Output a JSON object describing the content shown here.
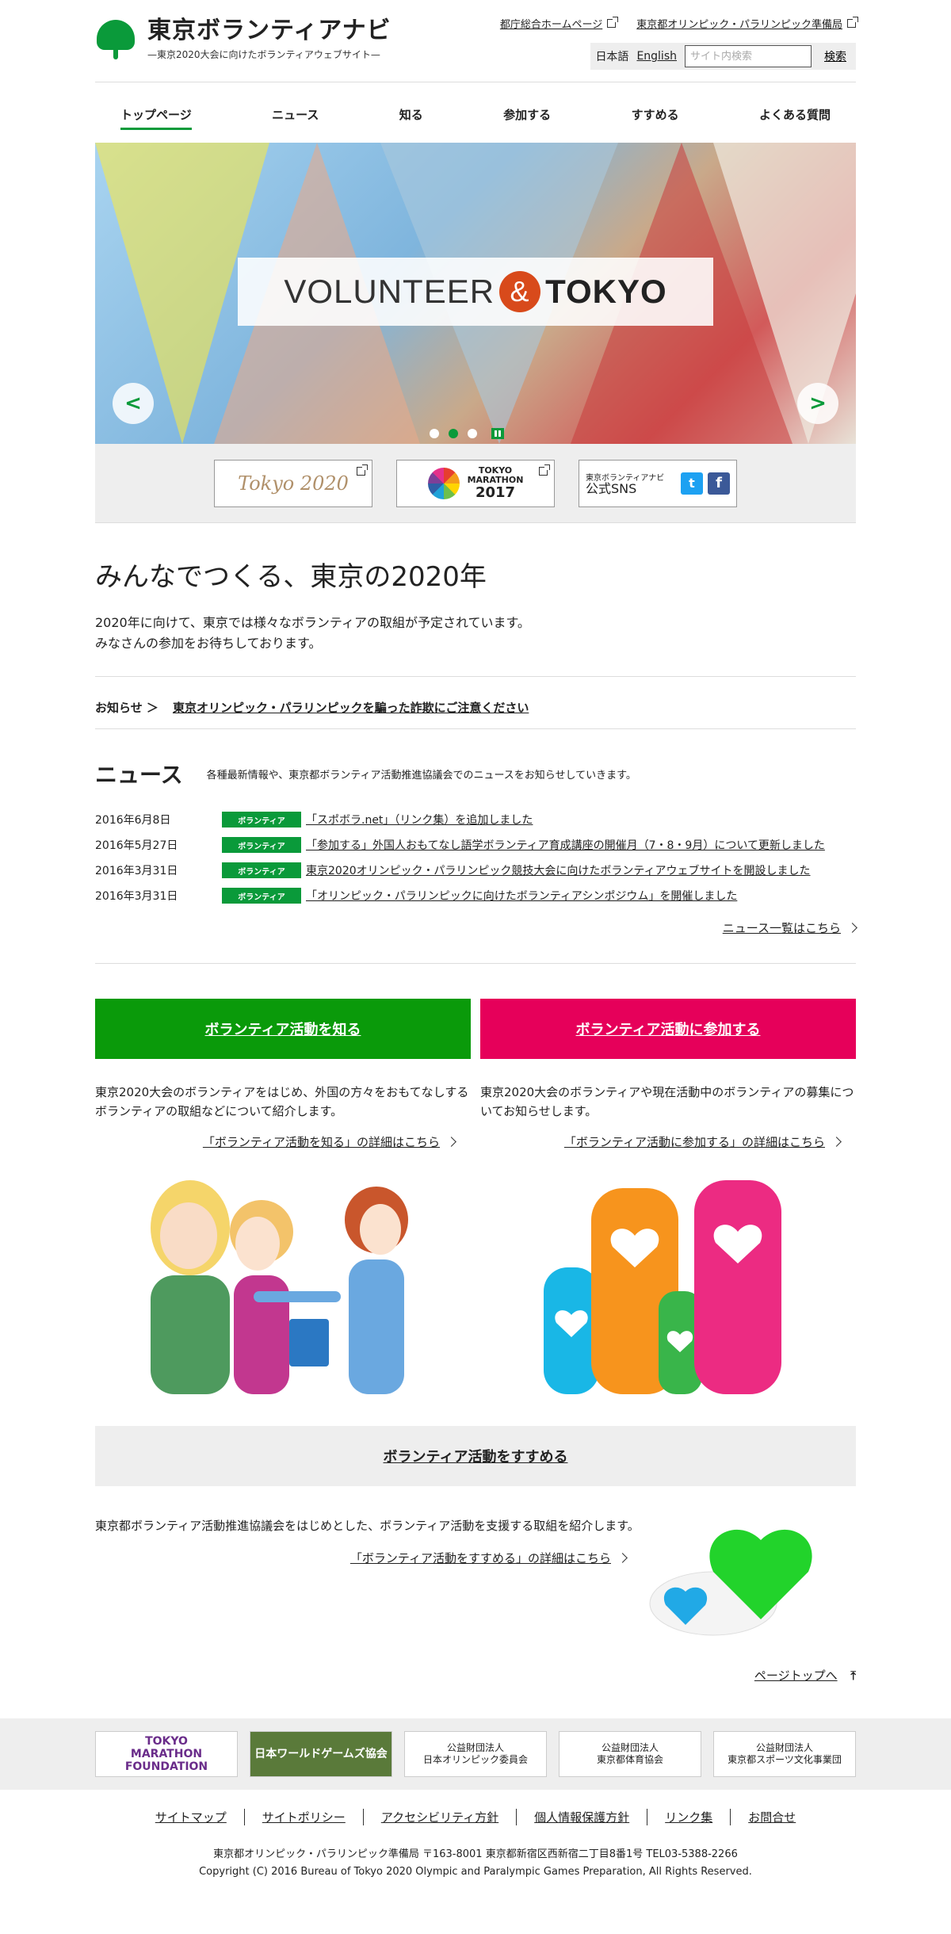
{
  "header": {
    "logo_title": "東京ボランティアナビ",
    "logo_sub": "—東京2020大会に向けたボランティアウェブサイト—",
    "toplinks": [
      "都庁総合ホームページ",
      "東京都オリンピック・パラリンピック準備局"
    ],
    "lang_ja": "日本語",
    "lang_en": "English",
    "search_placeholder": "サイト内検索",
    "search_button": "検索"
  },
  "nav": [
    "トップページ",
    "ニュース",
    "知る",
    "参加する",
    "すすめる",
    "よくある質問"
  ],
  "hero": {
    "title_left": "VOLUNTEER",
    "title_amp": "&",
    "title_right": "TOKYO",
    "prev": "<",
    "next": ">"
  },
  "banners": {
    "tokyo2020": "Tokyo 2020",
    "marathon_line1": "TOKYO",
    "marathon_line2": "MARATHON",
    "marathon_year": "2017",
    "sns_line1": "東京ボランティアナビ",
    "sns_line2": "公式SNS",
    "twitter": "t",
    "facebook": "f"
  },
  "intro": {
    "heading": "みんなでつくる、東京の2020年",
    "line1": "2020年に向けて、東京では様々なボランティアの取組が予定されています。",
    "line2": "みなさんの参加をお待ちしております。"
  },
  "notice": {
    "label": "お知らせ ＞",
    "link": "東京オリンピック・パラリンピックを騙った詐欺にご注意ください"
  },
  "news": {
    "heading": "ニュース",
    "desc": "各種最新情報や、東京都ボランティア活動推進協議会でのニュースをお知らせしていきます。",
    "items": [
      {
        "date": "2016年6月8日",
        "tag": "ボランティア",
        "title": "「スポボラ.net」（リンク集）を追加しました"
      },
      {
        "date": "2016年5月27日",
        "tag": "ボランティア",
        "title": "「参加する」外国人おもてなし語学ボランティア育成講座の開催月（7・8・9月）について更新しました"
      },
      {
        "date": "2016年3月31日",
        "tag": "ボランティア",
        "title": "東京2020オリンピック・パラリンピック競技大会に向けたボランティアウェブサイトを開設しました"
      },
      {
        "date": "2016年3月31日",
        "tag": "ボランティア",
        "title": "「オリンピック・パラリンピックに向けたボランティアシンポジウム」を開催しました"
      }
    ],
    "more": "ニュース一覧はこちら"
  },
  "know": {
    "button": "ボランティア活動を知る",
    "text": "東京2020大会のボランティアをはじめ、外国の方々をおもてなしするボランティアの取組などについて紹介します。",
    "more": "「ボランティア活動を知る」の詳細はこちら"
  },
  "join": {
    "button": "ボランティア活動に参加する",
    "text": "東京2020大会のボランティアや現在活動中のボランティアの募集についてお知らせします。",
    "more": "「ボランティア活動に参加する」の詳細はこちら"
  },
  "recommend": {
    "button": "ボランティア活動をすすめる",
    "text": "東京都ボランティア活動推進協議会をはじめとした、ボランティア活動を支援する取組を紹介します。",
    "more": "「ボランティア活動をすすめる」の詳細はこちら"
  },
  "pagetop": "ページトップへ",
  "partners": {
    "tmf_1": "TOKYO",
    "tmf_2": "MARATHON",
    "tmf_3": "FOUNDATION",
    "jsa": "日本ワールドゲームズ協会",
    "joc_1": "公益財団法人",
    "joc_2": "日本オリンピック委員会",
    "tasa_1": "公益財団法人",
    "tasa_2": "東京都体育協会",
    "tmsf_1": "公益財団法人",
    "tmsf_2": "東京都スポーツ文化事業団"
  },
  "footer": {
    "links": [
      "サイトマップ",
      "サイトポリシー",
      "アクセシビリティ方針",
      "個人情報保護方針",
      "リンク集",
      "お問合せ"
    ],
    "address": "東京都オリンピック・パラリンピック準備局 〒163-8001 東京都新宿区西新宿二丁目8番1号 TEL03-5388-2266",
    "copyright": "Copyright (C) 2016 Bureau of Tokyo 2020 Olympic and Paralympic Games Preparation, All Rights Reserved."
  },
  "colors": {
    "brand_green": "#0a9a3a",
    "join_pink": "#e6005a",
    "know_green": "#0a9a0a"
  }
}
